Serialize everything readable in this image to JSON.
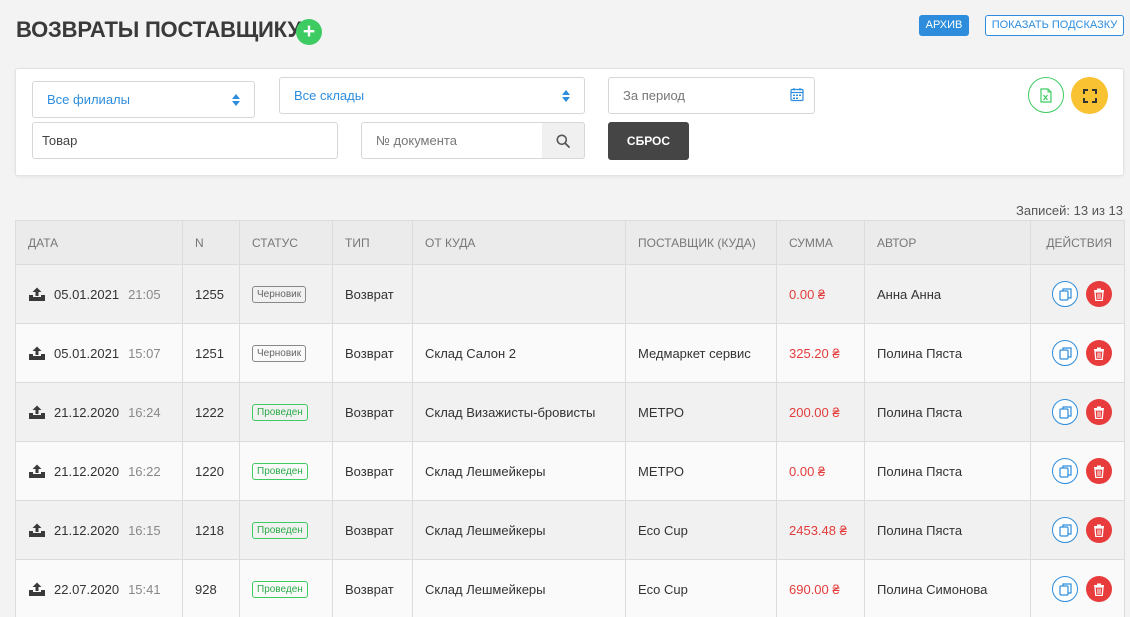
{
  "header": {
    "title": "ВОЗВРАТЫ ПОСТАВЩИКУ",
    "add_label": "+",
    "archive_label": "АРХИВ",
    "hint_label": "ПОКАЗАТЬ ПОДСКАЗКУ"
  },
  "filters": {
    "branches": "Все филиалы",
    "warehouses": "Все склады",
    "period_placeholder": "За период",
    "product_value": "Товар",
    "doc_placeholder": "№ документа",
    "reset_label": "СБРОС"
  },
  "records_label": "Записей: 13 из 13",
  "table": {
    "headers": {
      "date": "ДАТА",
      "n": "N",
      "status": "СТАТУС",
      "type": "ТИП",
      "from": "ОТ КУДА",
      "supplier": "ПОСТАВЩИК (КУДА)",
      "sum": "СУММА",
      "author": "АВТОР",
      "actions": "ДЕЙСТВИЯ"
    },
    "rows": [
      {
        "date": "05.01.2021",
        "time": "21:05",
        "n": "1255",
        "status": "Черновик",
        "type": "Возврат",
        "from": "",
        "supplier": "",
        "sum": "0.00 ₴",
        "author": "Анна Анна"
      },
      {
        "date": "05.01.2021",
        "time": "15:07",
        "n": "1251",
        "status": "Черновик",
        "type": "Возврат",
        "from": "Склад Салон 2",
        "supplier": "Медмаркет сервис",
        "sum": "325.20 ₴",
        "author": "Полина Пяста"
      },
      {
        "date": "21.12.2020",
        "time": "16:24",
        "n": "1222",
        "status": "Проведен",
        "type": "Возврат",
        "from": "Склад Визажисты-бровисты",
        "supplier": "МЕТРО",
        "sum": "200.00 ₴",
        "author": "Полина Пяста"
      },
      {
        "date": "21.12.2020",
        "time": "16:22",
        "n": "1220",
        "status": "Проведен",
        "type": "Возврат",
        "from": "Склад Лешмейкеры",
        "supplier": "МЕТРО",
        "sum": "0.00 ₴",
        "author": "Полина Пяста"
      },
      {
        "date": "21.12.2020",
        "time": "16:15",
        "n": "1218",
        "status": "Проведен",
        "type": "Возврат",
        "from": "Склад Лешмейкеры",
        "supplier": "Eco Cup",
        "sum": "2453.48 ₴",
        "author": "Полина Пяста"
      },
      {
        "date": "22.07.2020",
        "time": "15:41",
        "n": "928",
        "status": "Проведен",
        "type": "Возврат",
        "from": "Склад Лешмейкеры",
        "supplier": "Eco Cup",
        "sum": "690.00 ₴",
        "author": "Полина Симонова"
      }
    ]
  },
  "colors": {
    "accent": "#2d8ddc",
    "success": "#3ecc62",
    "danger": "#e83b3b",
    "warning": "#f9c233"
  },
  "icons": {
    "add": "plus-icon",
    "calendar": "calendar-icon",
    "search": "search-icon",
    "excel": "excel-icon",
    "fullscreen": "fullscreen-icon",
    "row": "upload-icon",
    "copy": "copy-icon",
    "delete": "trash-icon"
  }
}
